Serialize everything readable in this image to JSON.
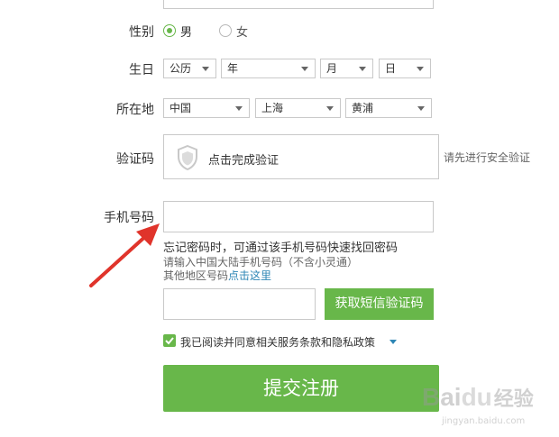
{
  "form": {
    "gender": {
      "label": "性别",
      "male": "男",
      "female": "女"
    },
    "birthday": {
      "label": "生日",
      "calendar": "公历",
      "year": "年",
      "month": "月",
      "day": "日"
    },
    "location": {
      "label": "所在地",
      "country": "中国",
      "province": "上海",
      "district": "黄浦"
    },
    "captcha": {
      "label": "验证码",
      "widget_text": "点击完成验证",
      "side_hint": "请先进行安全验证"
    },
    "phone": {
      "label": "手机号码",
      "value": "",
      "hint_main": "忘记密码时，可通过该手机号码快速找回密码",
      "hint_sub": "请输入中国大陆手机号码（不含小灵通）",
      "other_region_prefix": "其他地区号码",
      "other_region_link": "点击这里"
    },
    "sms": {
      "value": "",
      "button": "获取短信验证码"
    },
    "agreement": {
      "text": "我已阅读并同意相关服务条款和隐私政策",
      "checked": true
    },
    "submit": "提交注册"
  },
  "watermark": {
    "brand": "Bai",
    "paw": "du",
    "suffix": "经验",
    "url": "jingyan.baidu.com"
  },
  "colors": {
    "accent": "#68b74a",
    "link": "#2d86b5",
    "arrow": "#e0342b"
  }
}
